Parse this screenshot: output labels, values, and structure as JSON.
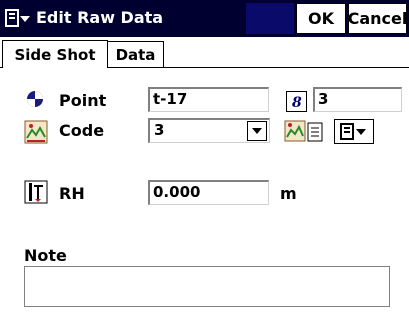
{
  "window": {
    "title": "Edit Raw Data",
    "ok_label": "OK",
    "cancel_label": "Cancel"
  },
  "tabs": [
    {
      "label": "Side Shot",
      "active": true
    },
    {
      "label": "Data",
      "active": false
    }
  ],
  "point": {
    "label": "Point",
    "value": "t-17",
    "code_num": "3"
  },
  "code": {
    "label": "Code",
    "value": "3"
  },
  "rh": {
    "label": "RH",
    "value": "0.000",
    "unit": "m"
  },
  "note": {
    "label": "Note",
    "value": ""
  },
  "colors": {
    "titlebar": "#000030",
    "accent_block": "#0a0a6a"
  }
}
